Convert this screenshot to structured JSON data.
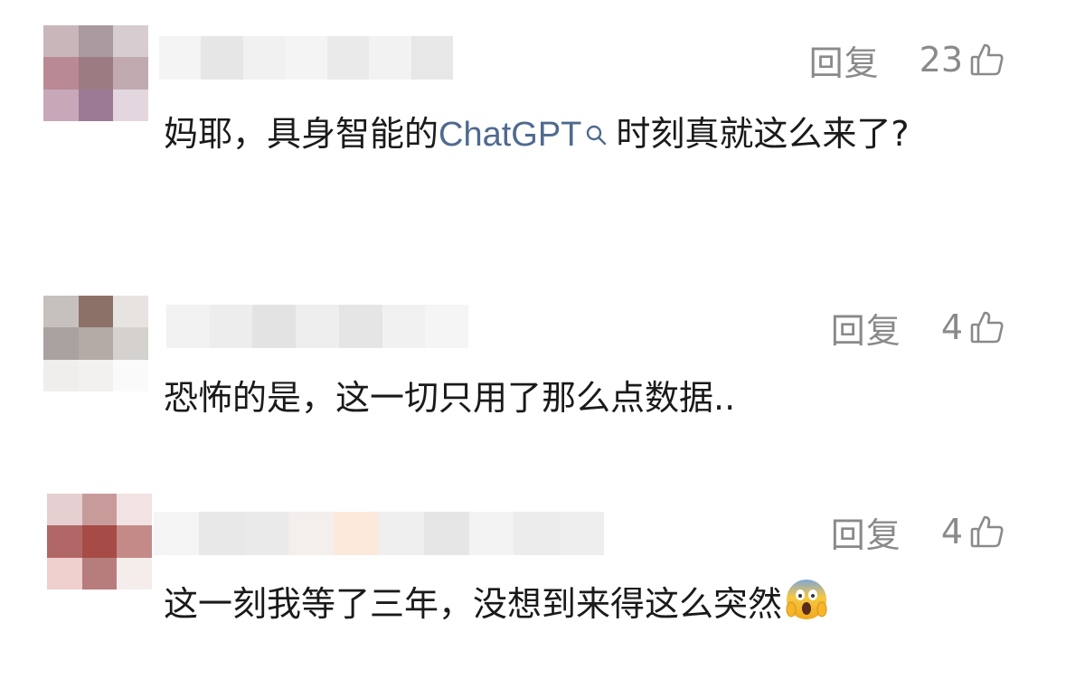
{
  "comments": [
    {
      "reply_label": "回复",
      "like_count": "23",
      "text_before": "妈耶，具身智能的",
      "link_text": "ChatGPT",
      "text_after": "时刻真就这么来了?",
      "like_icon": "thumbs-up-outline",
      "link_icon": "search"
    },
    {
      "reply_label": "回复",
      "like_count": "4",
      "text": "恐怖的是，这一切只用了那么点数据..",
      "like_icon": "thumbs-up-outline"
    },
    {
      "reply_label": "回复",
      "like_count": "4",
      "text": "这一刻我等了三年，没想到来得这么突然",
      "emoji": "screaming-face",
      "like_icon": "thumbs-up-outline"
    }
  ]
}
